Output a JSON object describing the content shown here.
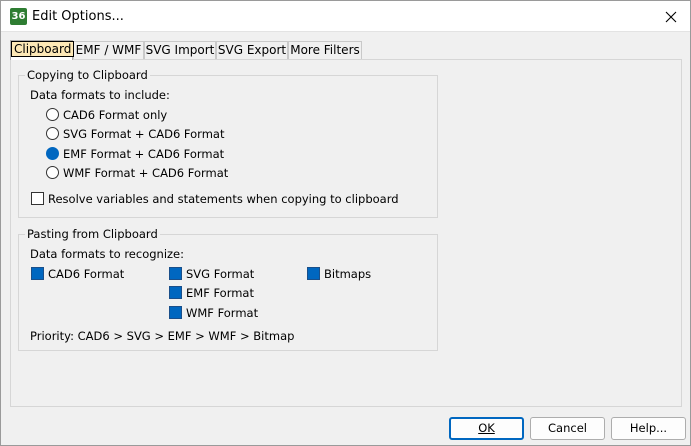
{
  "window": {
    "title": "Edit Options...",
    "app_icon": "36"
  },
  "tabs": [
    {
      "label": "Clipboard",
      "active": true
    },
    {
      "label": "EMF / WMF",
      "active": false
    },
    {
      "label": "SVG Import",
      "active": false
    },
    {
      "label": "SVG Export",
      "active": false
    },
    {
      "label": "More Filters",
      "active": false
    }
  ],
  "copying": {
    "group_title": "Copying to Clipboard",
    "formats_label": "Data formats to include:",
    "options": [
      {
        "label": "CAD6 Format only",
        "checked": false
      },
      {
        "label": "SVG Format + CAD6 Format",
        "checked": false
      },
      {
        "label": "EMF Format + CAD6 Format",
        "checked": true
      },
      {
        "label": "WMF Format + CAD6 Format",
        "checked": false
      }
    ],
    "resolve_label": "Resolve variables and statements when copying to clipboard",
    "resolve_checked": false
  },
  "pasting": {
    "group_title": "Pasting from Clipboard",
    "formats_label": "Data formats to recognize:",
    "formats": [
      {
        "label": "CAD6 Format",
        "checked": true
      },
      {
        "label": "SVG Format",
        "checked": true
      },
      {
        "label": "EMF Format",
        "checked": true
      },
      {
        "label": "WMF Format",
        "checked": true
      },
      {
        "label": "Bitmaps",
        "checked": true
      }
    ],
    "priority_text": "Priority:  CAD6 > SVG > EMF > WMF > Bitmap"
  },
  "buttons": {
    "ok": "OK",
    "cancel": "Cancel",
    "help": "Help..."
  },
  "colors": {
    "accent": "#0067c0",
    "app_icon_bg": "#2e7d32"
  }
}
